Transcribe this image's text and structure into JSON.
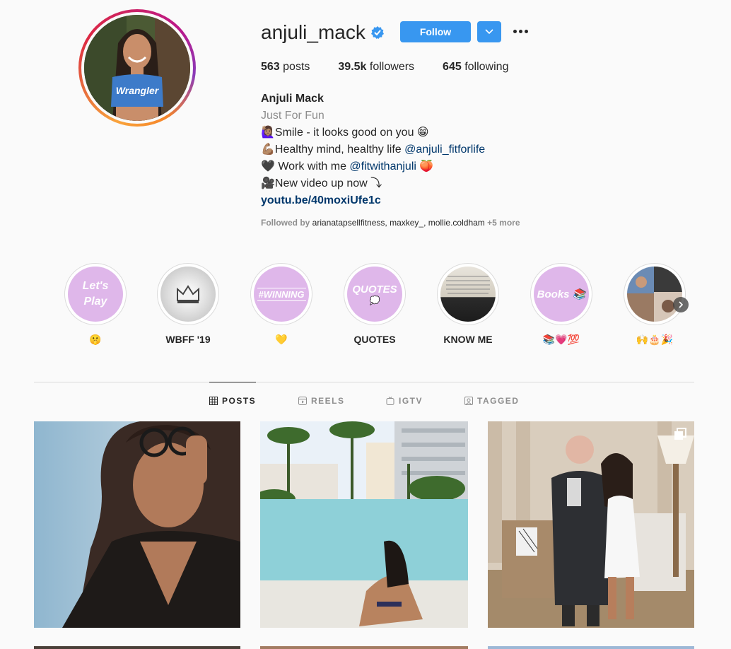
{
  "profile": {
    "username": "anjuli_mack",
    "follow_label": "Follow",
    "stats": {
      "posts_count": "563",
      "posts_label": "posts",
      "followers_count": "39.5k",
      "followers_label": "followers",
      "following_count": "645",
      "following_label": "following"
    },
    "bio": {
      "name": "Anjuli Mack",
      "category": "Just For Fun",
      "line1": "🙋🏽‍♀️Smile - it looks good on you 😁",
      "line2_text": "💪🏽Healthy mind, healthy life ",
      "line2_mention": "@anjuli_fitforlife",
      "line3_text": "🖤 Work with me ",
      "line3_mention": "@fitwithanjuli",
      "line3_emoji": " 🍑",
      "line4": "🎥New video up now ⤵",
      "link": "youtu.be/40moxiUfe1c"
    },
    "followed_by": {
      "prefix": "Followed by ",
      "names": "arianatapsellfitness, maxkey_, mollie.coldham",
      "more": " +5 more"
    }
  },
  "highlights": [
    {
      "cover_text": "Let's Play",
      "label": "🤫"
    },
    {
      "cover_text": "",
      "label": "WBFF '19"
    },
    {
      "cover_text": "#WINNING",
      "label": "💛"
    },
    {
      "cover_text": "QUOTES",
      "label": "QUOTES"
    },
    {
      "cover_text": "",
      "label": "KNOW ME"
    },
    {
      "cover_text": "Books 📚",
      "label": "📚💗💯"
    },
    {
      "cover_text": "",
      "label": "🙌🎂🎉"
    }
  ],
  "tabs": [
    {
      "label": "POSTS",
      "icon": "grid-icon"
    },
    {
      "label": "REELS",
      "icon": "reels-icon"
    },
    {
      "label": "IGTV",
      "icon": "igtv-icon"
    },
    {
      "label": "TAGGED",
      "icon": "tagged-icon"
    }
  ],
  "colors": {
    "accent": "#3897f0",
    "link": "#00376b",
    "muted": "#8e8e8e",
    "highlight_pink": "#dfb7ea"
  }
}
